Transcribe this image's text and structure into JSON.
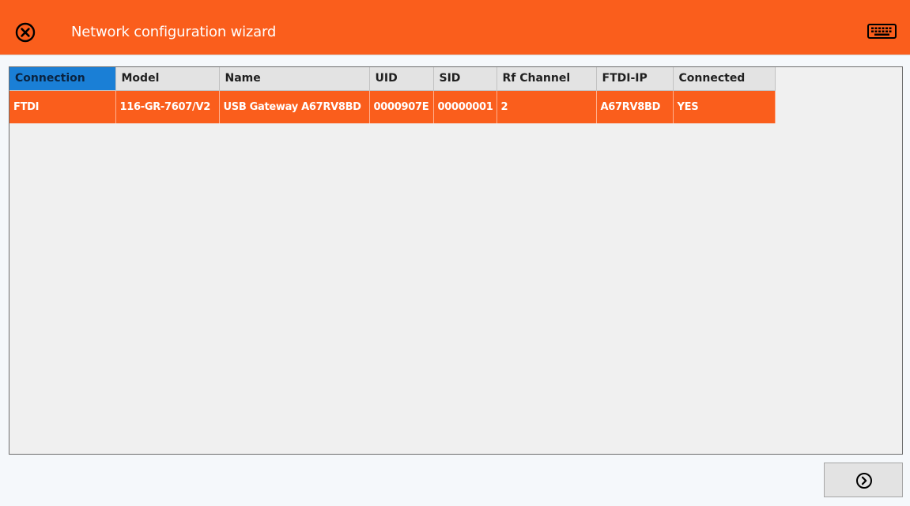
{
  "window": {
    "title": "Network configuration wizard"
  },
  "icons": {
    "close": "close-circle-icon",
    "keyboard": "keyboard-icon",
    "next": "chevron-right-circle-icon"
  },
  "colors": {
    "accent": "#fa5e1c",
    "header_selected": "#1a7fd6",
    "header_bg": "#e3e3e3",
    "grid_bg": "#f0f0f0"
  },
  "table": {
    "columns": [
      "Connection",
      "Model",
      "Name",
      "UID",
      "SID",
      "Rf Channel",
      "FTDI-IP",
      "Connected"
    ],
    "rows": [
      [
        "FTDI",
        "116-GR-7607/V2",
        "USB Gateway A67RV8BD",
        "0000907E",
        "00000001",
        "2",
        "A67RV8BD",
        "YES"
      ]
    ]
  }
}
